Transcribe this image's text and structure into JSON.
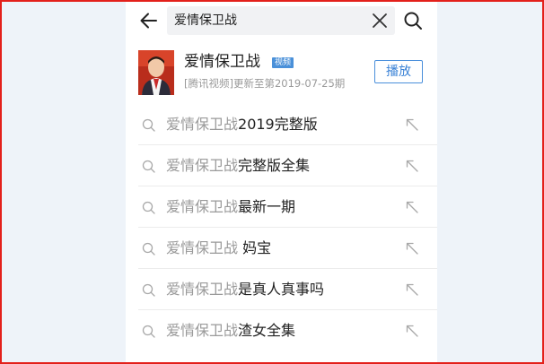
{
  "search": {
    "query": "爱情保卫战"
  },
  "top_result": {
    "title": "爱情保卫战",
    "badge": "视频",
    "subtitle": "[腾讯视频]更新至第2019-07-25期",
    "play_label": "播放"
  },
  "suggestions": [
    {
      "prefix": "爱情保卫战",
      "suffix": "2019完整版"
    },
    {
      "prefix": "爱情保卫战",
      "suffix": "完整版全集"
    },
    {
      "prefix": "爱情保卫战",
      "suffix": "最新一期"
    },
    {
      "prefix": "爱情保卫战",
      "suffix": " 妈宝"
    },
    {
      "prefix": "爱情保卫战",
      "suffix": "是真人真事吗"
    },
    {
      "prefix": "爱情保卫战",
      "suffix": "渣女全集"
    }
  ],
  "icons": {
    "back": "arrow-left-icon",
    "clear": "close-icon",
    "search": "search-icon",
    "suggestion": "search-icon",
    "fill": "arrow-up-left-icon"
  },
  "colors": {
    "frame_border": "#e3201b",
    "accent": "#3a82d6",
    "badge": "#4a90d9",
    "muted_text": "#9a9a9a",
    "page_background": "#eef3f9"
  }
}
